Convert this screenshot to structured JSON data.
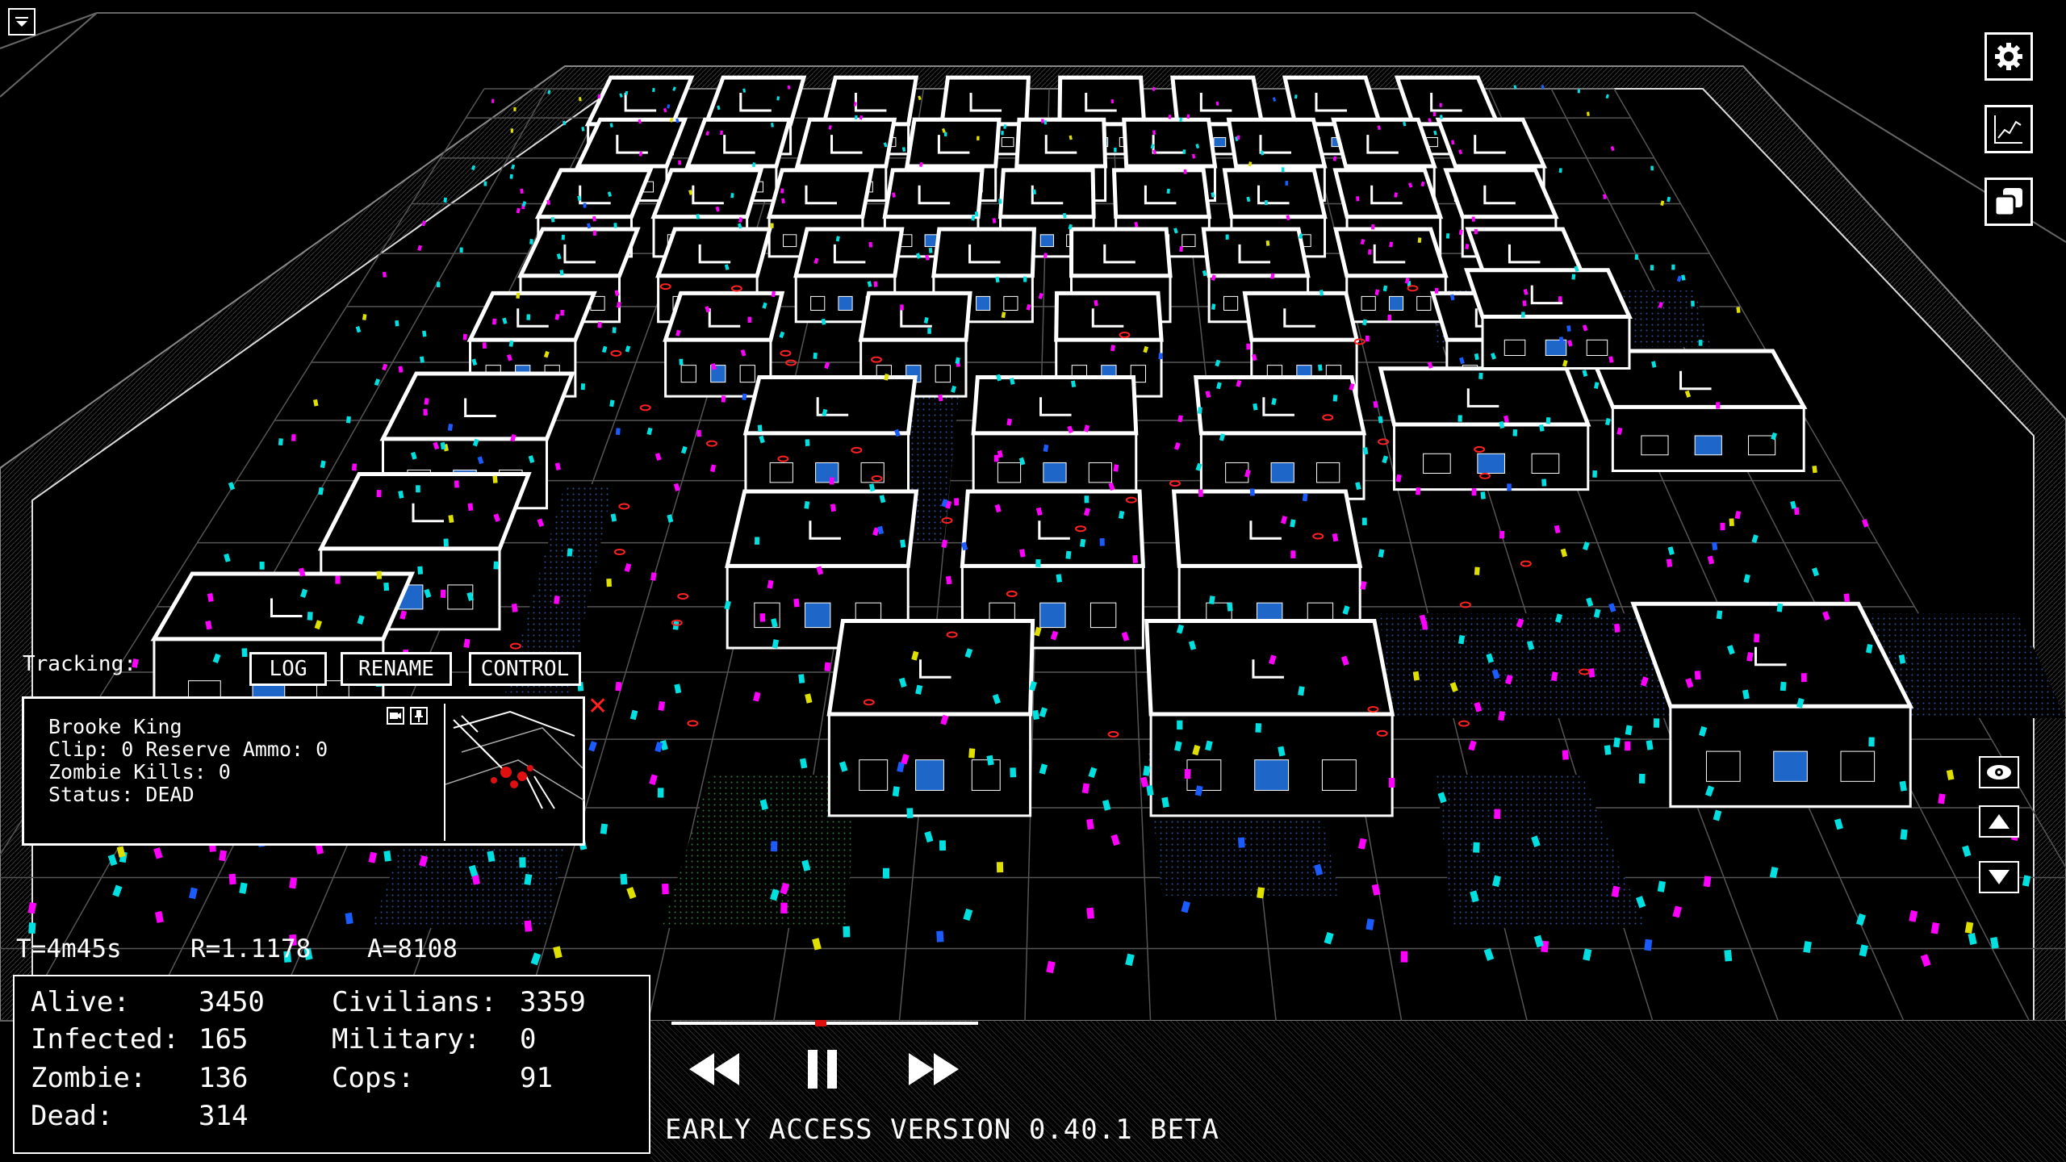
{
  "topbar": {
    "menu_icon": "dropdown-icon",
    "buttons": [
      {
        "name": "settings-button",
        "icon": "gear-icon"
      },
      {
        "name": "stats-graph-button",
        "icon": "chart-icon"
      },
      {
        "name": "windows-button",
        "icon": "copy-icon"
      }
    ]
  },
  "tracking": {
    "label": "Tracking:",
    "buttons": {
      "log": "LOG",
      "rename": "RENAME",
      "control": "CONTROL"
    },
    "name": "Brooke King",
    "clip_line": "Clip: 0 Reserve Ammo: 0",
    "kills_line": "Zombie Kills: 0",
    "status_line": "Status: DEAD",
    "close_glyph": "✕"
  },
  "readout": {
    "time": "T=4m45s",
    "rate": "R=1.1178",
    "area": "A=8108"
  },
  "stats": {
    "alive_label": "Alive:",
    "alive": "3450",
    "infected_label": "Infected:",
    "infected": "165",
    "zombie_label": "Zombie:",
    "zombie": "136",
    "dead_label": "Dead:",
    "dead": "314",
    "civilians_label": "Civilians:",
    "civilians": "3359",
    "military_label": "Military:",
    "military": "0",
    "cops_label": "Cops:",
    "cops": "91"
  },
  "playback": {
    "rewind_icon": "rewind-icon",
    "pause_icon": "pause-icon",
    "forward_icon": "fast-forward-icon",
    "progress": 0.5
  },
  "version": "EARLY ACCESS VERSION 0.40.1 BETA",
  "camera": {
    "eye_icon": "eye-icon",
    "up_icon": "arrow-up-icon",
    "down_icon": "arrow-down-icon"
  },
  "colors": {
    "zombie": "#ff00ff",
    "civilian": "#00e0e0",
    "cop": "#1a5cff",
    "military": "#e0e000",
    "window": "#2a7fd0",
    "dead": "#ff2020"
  }
}
